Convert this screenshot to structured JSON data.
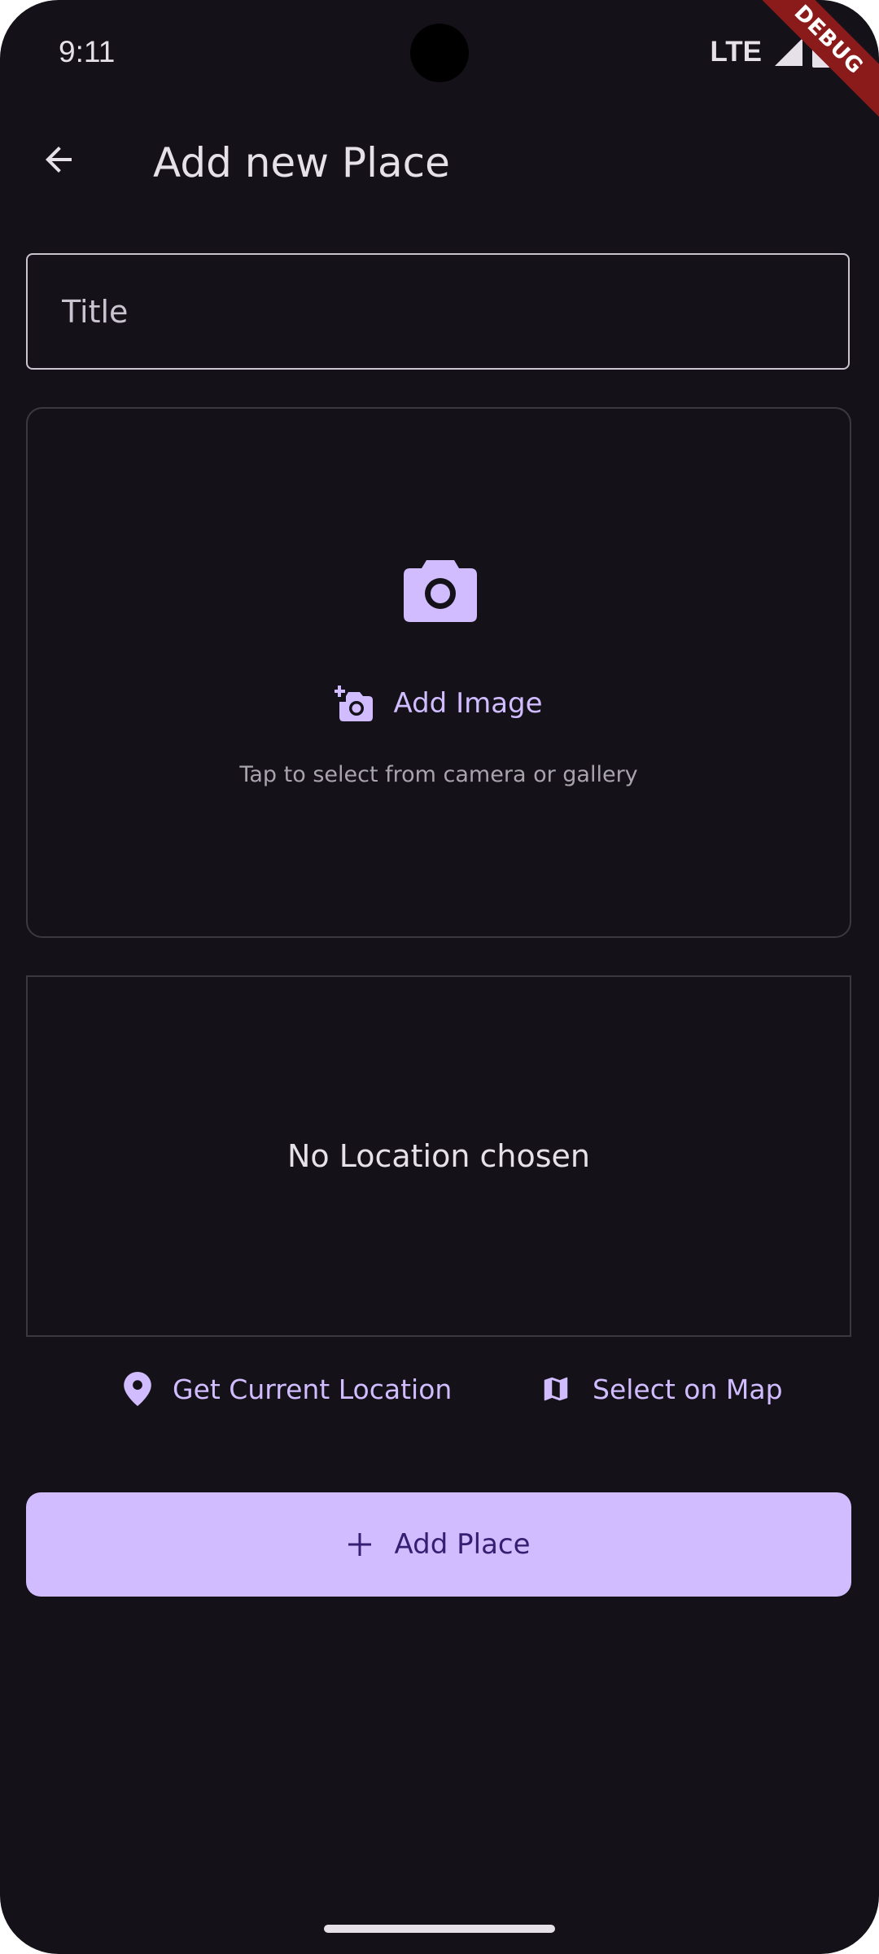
{
  "status_bar": {
    "time": "9:11",
    "network": "LTE",
    "debug_banner": "DEBUG"
  },
  "app_bar": {
    "title": "Add new Place",
    "back_icon": "arrow-back-icon"
  },
  "form": {
    "title_placeholder": "Title",
    "title_value": ""
  },
  "image_picker": {
    "button_label": "Add Image",
    "hint": "Tap to select from camera or gallery",
    "icon": "camera-icon",
    "button_icon": "add-a-photo-icon"
  },
  "location": {
    "empty_text": "No Location chosen",
    "current_label": "Get Current Location",
    "current_icon": "location-pin-icon",
    "map_label": "Select on Map",
    "map_icon": "map-icon"
  },
  "submit": {
    "label": "Add Place",
    "icon": "plus-icon"
  },
  "colors": {
    "background": "#141218",
    "primary": "#d0bcff",
    "on_primary": "#381e72",
    "on_surface": "#e6e0e9",
    "outline": "#cac4d0",
    "debug_ribbon": "#8b1a1a"
  }
}
